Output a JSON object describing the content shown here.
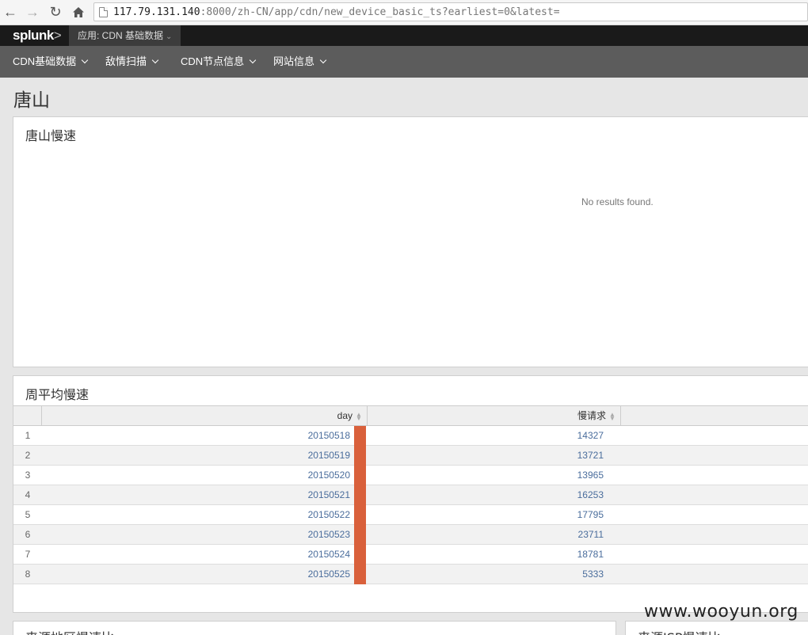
{
  "browser": {
    "url_host": "117.79.131.140",
    "url_rest": ":8000/zh-CN/app/cdn/new_device_basic_ts?earliest=0&latest="
  },
  "appbar": {
    "logo": "splunk",
    "logo_suffix": ">",
    "app_label": "应用: CDN 基础数据"
  },
  "nav": {
    "items": [
      {
        "label": "CDN基础数据"
      },
      {
        "label": "敌情扫描"
      },
      {
        "label": "CDN节点信息"
      },
      {
        "label": "网站信息"
      }
    ]
  },
  "page": {
    "title": "唐山"
  },
  "panel1": {
    "title": "唐山慢速",
    "message": "No results found."
  },
  "panel2": {
    "title": "周平均慢速",
    "columns": [
      "day",
      "慢请求"
    ],
    "rows": [
      {
        "idx": "1",
        "day": "20150518",
        "value": "14327"
      },
      {
        "idx": "2",
        "day": "20150519",
        "value": "13721"
      },
      {
        "idx": "3",
        "day": "20150520",
        "value": "13965"
      },
      {
        "idx": "4",
        "day": "20150521",
        "value": "16253"
      },
      {
        "idx": "5",
        "day": "20150522",
        "value": "17795"
      },
      {
        "idx": "6",
        "day": "20150523",
        "value": "23711"
      },
      {
        "idx": "7",
        "day": "20150524",
        "value": "18781"
      },
      {
        "idx": "8",
        "day": "20150525",
        "value": "5333"
      }
    ]
  },
  "panel3": {
    "title": "来源地区慢速比"
  },
  "panel4": {
    "title": "来源ISP慢速比"
  },
  "watermark": "www.wooyun.org",
  "colors": {
    "accent_bar": "#d9603b",
    "link": "#4a6d9c"
  }
}
